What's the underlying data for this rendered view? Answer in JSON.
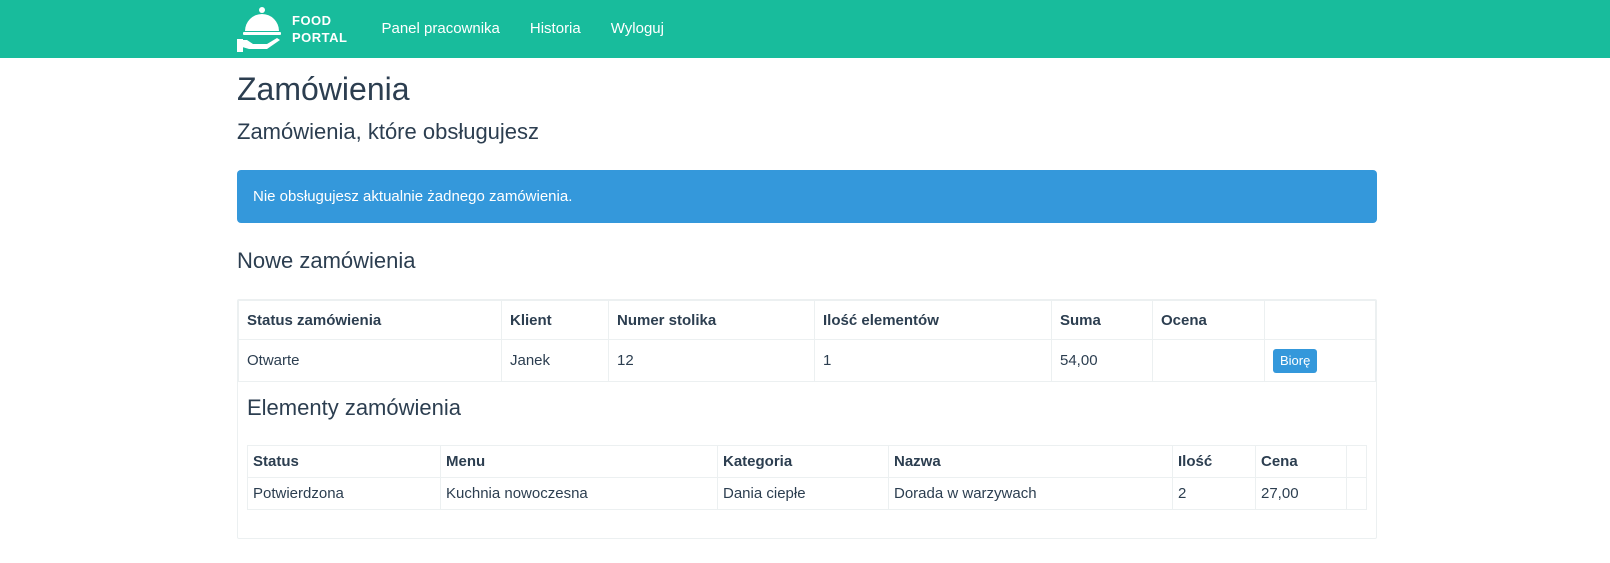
{
  "navbar": {
    "brand_line1": "FOOD",
    "brand_line2": "PORTAL",
    "links": [
      "Panel pracownika",
      "Historia",
      "Wyloguj"
    ]
  },
  "page": {
    "title": "Zamówienia",
    "subtitle": "Zamówienia, które obsługujesz",
    "alert": "Nie obsługujesz aktualnie żadnego zamówienia.",
    "new_orders_title": "Nowe zamówienia"
  },
  "orders_table": {
    "headers": [
      "Status zamówienia",
      "Klient",
      "Numer stolika",
      "Ilość elementów",
      "Suma",
      "Ocena",
      ""
    ],
    "row": {
      "status": "Otwarte",
      "client": "Janek",
      "table_number": "12",
      "item_count": "1",
      "total": "54,00",
      "rating": "",
      "action_label": "Biorę"
    }
  },
  "items_section": {
    "title": "Elementy zamówienia",
    "headers": [
      "Status",
      "Menu",
      "Kategoria",
      "Nazwa",
      "Ilość",
      "Cena",
      ""
    ],
    "rows": [
      {
        "status": "Potwierdzona",
        "menu": "Kuchnia nowoczesna",
        "category": "Dania ciepłe",
        "name": "Dorada w warzywach",
        "quantity": "2",
        "price": "27,00"
      }
    ]
  },
  "colors": {
    "navbar": "#18bc9c",
    "alert": "#3498db",
    "text": "#2c3e50"
  }
}
